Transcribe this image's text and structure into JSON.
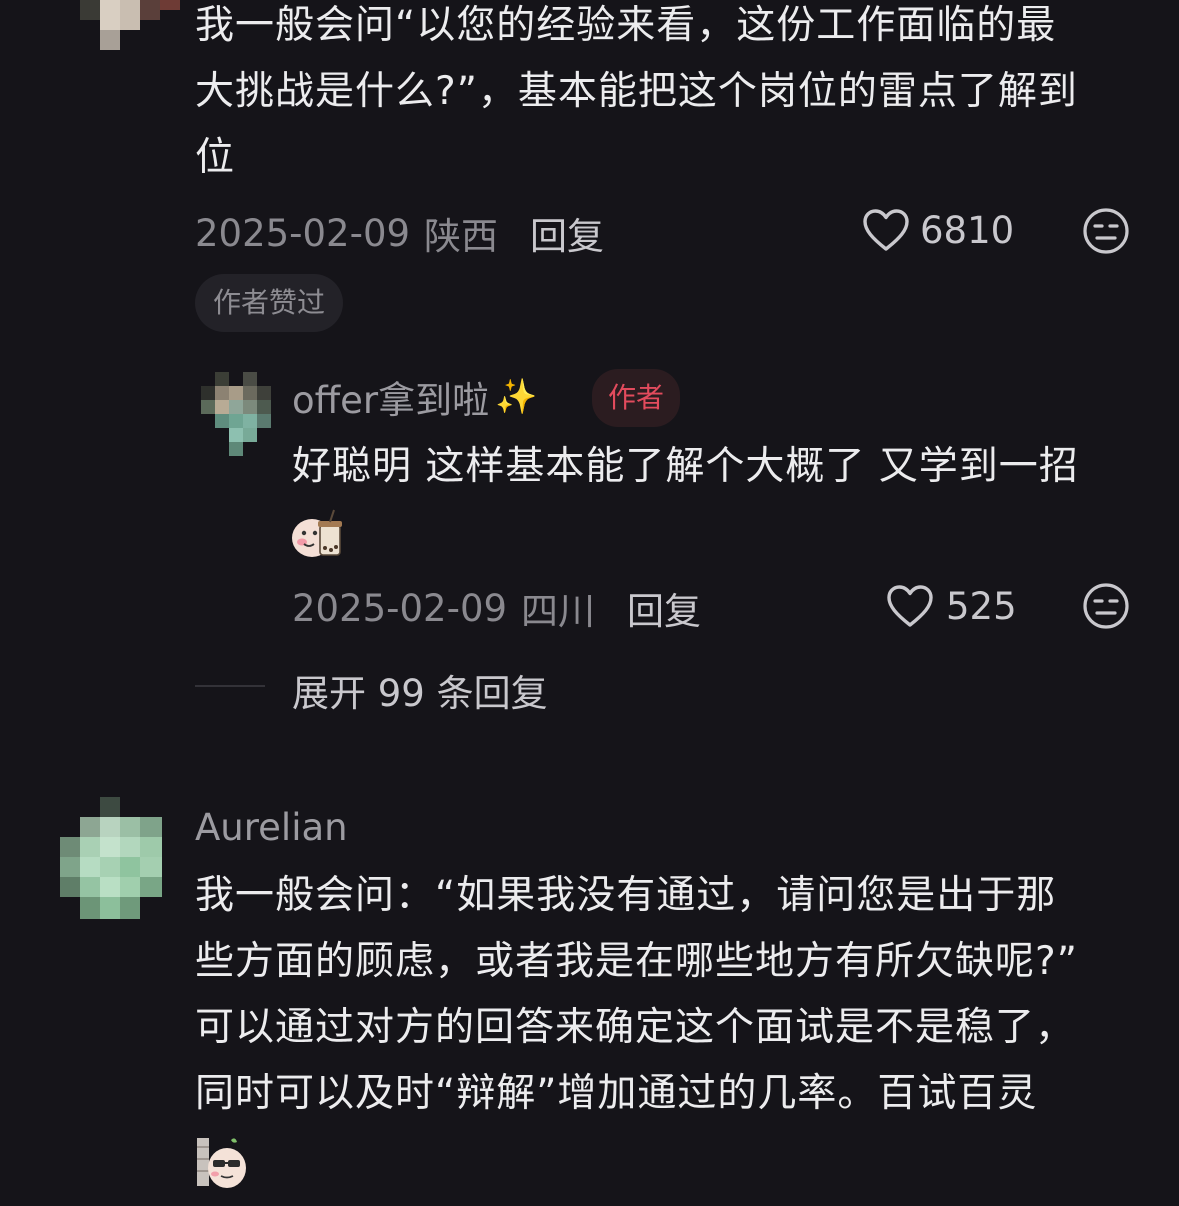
{
  "comment1": {
    "text_lines": [
      "我一般会问“以您的经验来看，这份工作面临的最",
      "大挑战是什么?”，基本能把这个岗位的雷点了解到",
      "位"
    ],
    "date": "2025-02-09",
    "location": "陕西",
    "reply_label": "回复",
    "likes": "6810",
    "liked_badge": "作者赞过"
  },
  "reply1": {
    "username": "offer拿到啦",
    "username_emoji": "✨",
    "author_tag": "作者",
    "text": "好聪明 这样基本能了解个大概了 又学到一招",
    "date": "2025-02-09",
    "location": "四川",
    "reply_label": "回复",
    "likes": "525"
  },
  "expand": {
    "label": "展开 99 条回复"
  },
  "comment2": {
    "username": "Aurelian",
    "text_lines": [
      "我一般会问：“如果我没有通过，请问您是出于那",
      "些方面的顾虑，或者我是在哪些地方有所欠缺呢?”",
      "可以通过对方的回答来确定这个面试是不是稳了，",
      "同时可以及时“辩解”增加通过的几率。百试百灵"
    ]
  },
  "colors": {
    "background": "#151419",
    "author_tag": "#e24b5d",
    "muted": "#8a898f"
  },
  "icons": {
    "like": "heart-outline-icon",
    "dislike": "meh-face-icon",
    "sticker1": "bubble-tea-sticker",
    "sticker2": "sunglasses-sticker"
  }
}
